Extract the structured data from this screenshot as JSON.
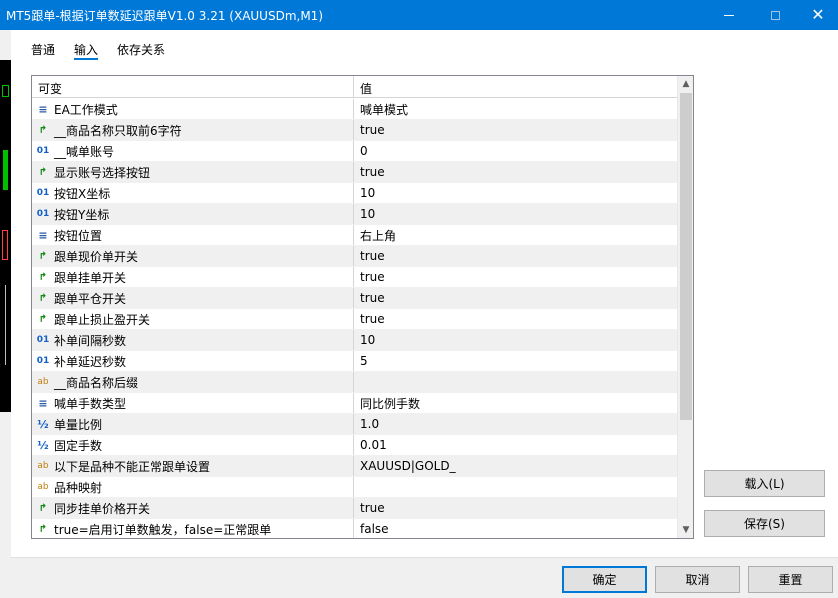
{
  "window": {
    "title": "MT5跟单-根据订单数延迟跟单V1.0 3.21 (XAUUSDm,M1)",
    "close_glyph": "✕"
  },
  "tabs": [
    {
      "label": "普通",
      "active": false
    },
    {
      "label": "输入",
      "active": true
    },
    {
      "label": "依存关系",
      "active": false
    }
  ],
  "grid": {
    "col_variable": "可变",
    "col_value": "值",
    "rows": [
      {
        "icon": "enum-icon",
        "glyph": "≡",
        "name": "EA工作模式",
        "value": "喊单模式"
      },
      {
        "icon": "bool-icon",
        "glyph": "↱",
        "name": "__商品名称只取前6字符",
        "value": "true"
      },
      {
        "icon": "int-icon",
        "glyph": "01",
        "name": "__喊单账号",
        "value": "0"
      },
      {
        "icon": "bool-icon",
        "glyph": "↱",
        "name": "显示账号选择按钮",
        "value": "true"
      },
      {
        "icon": "int-icon",
        "glyph": "01",
        "name": "按钮X坐标",
        "value": "10"
      },
      {
        "icon": "int-icon",
        "glyph": "01",
        "name": "按钮Y坐标",
        "value": "10"
      },
      {
        "icon": "enum-icon",
        "glyph": "≡",
        "name": "按钮位置",
        "value": "右上角"
      },
      {
        "icon": "bool-icon",
        "glyph": "↱",
        "name": "跟单现价单开关",
        "value": "true"
      },
      {
        "icon": "bool-icon",
        "glyph": "↱",
        "name": "跟单挂单开关",
        "value": "true"
      },
      {
        "icon": "bool-icon",
        "glyph": "↱",
        "name": "跟单平仓开关",
        "value": "true"
      },
      {
        "icon": "bool-icon",
        "glyph": "↱",
        "name": "跟单止损止盈开关",
        "value": "true"
      },
      {
        "icon": "int-icon",
        "glyph": "01",
        "name": "补单间隔秒数",
        "value": "10"
      },
      {
        "icon": "int-icon",
        "glyph": "01",
        "name": "补单延迟秒数",
        "value": "5"
      },
      {
        "icon": "string-icon",
        "glyph": "ab",
        "name": "__商品名称后缀",
        "value": ""
      },
      {
        "icon": "enum-icon",
        "glyph": "≡",
        "name": "喊单手数类型",
        "value": "同比例手数"
      },
      {
        "icon": "double-icon",
        "glyph": "½",
        "name": "单量比例",
        "value": "1.0"
      },
      {
        "icon": "double-icon",
        "glyph": "½",
        "name": "固定手数",
        "value": "0.01"
      },
      {
        "icon": "string-icon",
        "glyph": "ab",
        "name": "以下是品种不能正常跟单设置",
        "value": "XAUUSD|GOLD_"
      },
      {
        "icon": "string-icon",
        "glyph": "ab",
        "name": "品种映射",
        "value": ""
      },
      {
        "icon": "bool-icon",
        "glyph": "↱",
        "name": "同步挂单价格开关",
        "value": "true"
      },
      {
        "icon": "bool-icon",
        "glyph": "↱",
        "name": "true=启用订单数触发，false=正常跟单",
        "value": "false"
      }
    ]
  },
  "scrollbar": {
    "up_glyph": "▲",
    "down_glyph": "▼"
  },
  "side_buttons": {
    "load_label": "载入(L)",
    "save_label": "保存(S)"
  },
  "footer": {
    "ok_label": "确定",
    "cancel_label": "取消",
    "reset_label": "重置"
  },
  "colors": {
    "titlebar": "#0078d7",
    "row_alt": "#f0f0f0",
    "accent": "#0078d7"
  }
}
